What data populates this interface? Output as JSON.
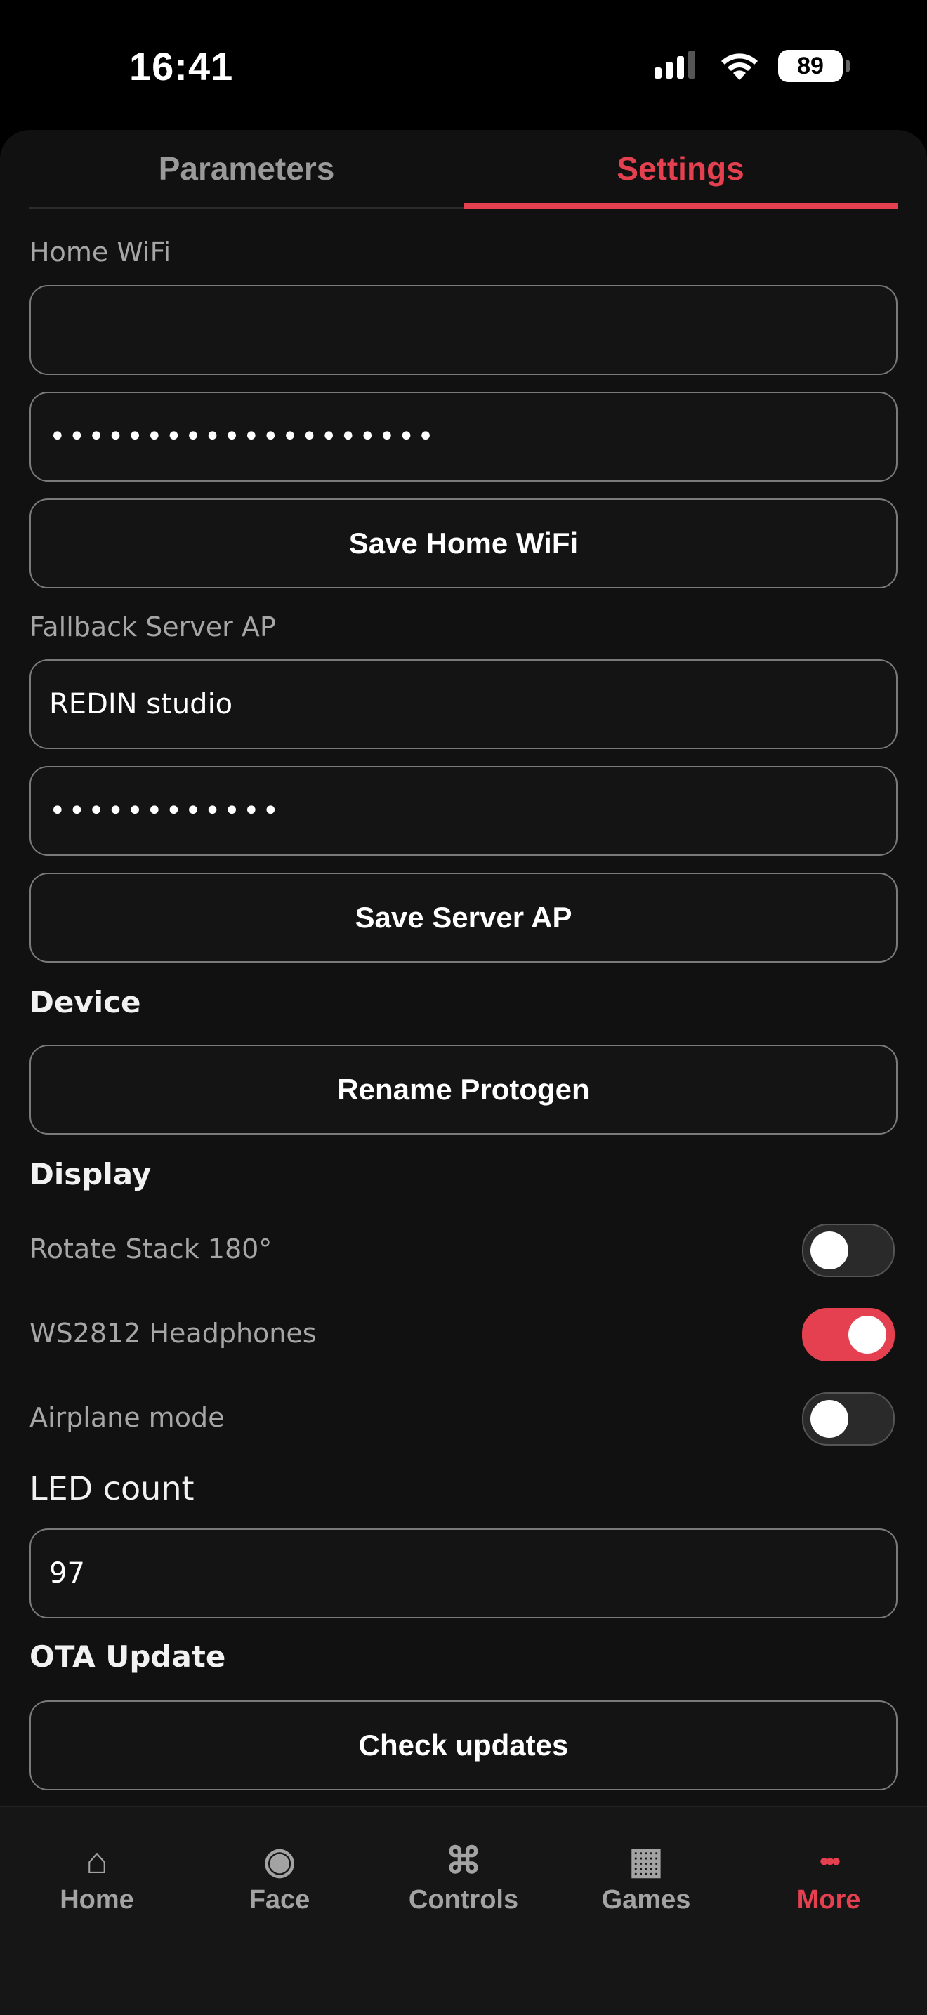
{
  "status_bar": {
    "time": "16:41",
    "battery": "89"
  },
  "tabs": [
    {
      "label": "Parameters"
    },
    {
      "label": "Settings"
    }
  ],
  "home_wifi": {
    "label": "Home WiFi",
    "ssid_value": "",
    "password_mask": "••••••••••••••••••••",
    "save_label": "Save Home WiFi"
  },
  "server_ap": {
    "label": "Fallback Server AP",
    "ssid_value": "REDIN studio",
    "password_mask": "••••••••••••",
    "save_label": "Save Server AP"
  },
  "device": {
    "title": "Device",
    "rename_label": "Rename Protogen"
  },
  "display": {
    "title": "Display",
    "toggles": [
      {
        "label": "Rotate Stack 180°",
        "on": false
      },
      {
        "label": "WS2812 Headphones",
        "on": true
      },
      {
        "label": "Airplane mode",
        "on": false
      }
    ]
  },
  "led": {
    "title": "LED count",
    "value": "97"
  },
  "ota": {
    "title": "OTA Update",
    "check_label": "Check updates"
  },
  "bottom_nav": [
    {
      "label": "Home",
      "icon": "home-icon",
      "glyph": "⌂"
    },
    {
      "label": "Face",
      "icon": "face-icon",
      "glyph": "◉"
    },
    {
      "label": "Controls",
      "icon": "command-icon",
      "glyph": "⌘"
    },
    {
      "label": "Games",
      "icon": "grid-icon",
      "glyph": "▦"
    },
    {
      "label": "More",
      "icon": "more-icon",
      "glyph": "•••"
    }
  ],
  "colors": {
    "accent": "#e5404f",
    "background": "#111111"
  }
}
